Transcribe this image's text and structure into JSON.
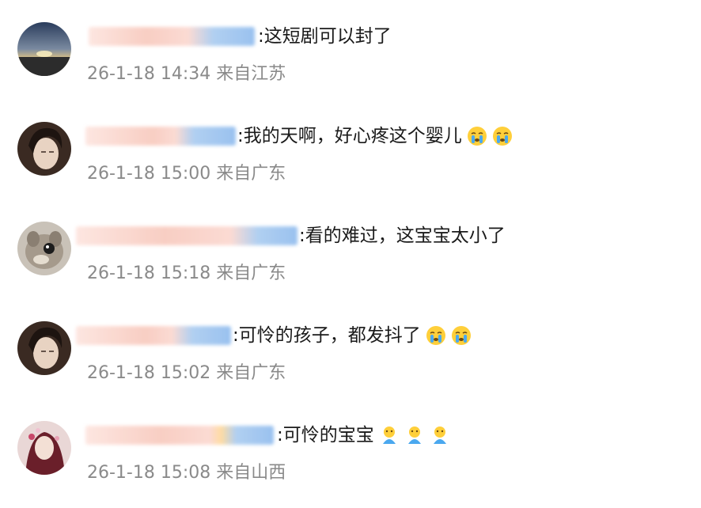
{
  "comments": [
    {
      "text": ":这短剧可以封了",
      "date": "26-1-18 14:34",
      "location": "来自江苏",
      "emojis": []
    },
    {
      "text": ":我的天啊，好心疼这个婴儿",
      "date": "26-1-18 15:00",
      "location": "来自广东",
      "emojis": [
        "crying-face-icon",
        "crying-face-icon"
      ]
    },
    {
      "text": ":看的难过，这宝宝太小了",
      "date": "26-1-18 15:18",
      "location": "来自广东",
      "emojis": []
    },
    {
      "text": ":可怜的孩子，都发抖了",
      "date": "26-1-18 15:02",
      "location": "来自广东",
      "emojis": [
        "crying-face-icon",
        "crying-face-icon"
      ]
    },
    {
      "text": ":可怜的宝宝",
      "date": "26-1-18 15:08",
      "location": "来自山西",
      "emojis": [
        "shivering-person-icon",
        "shivering-person-icon",
        "shivering-person-icon"
      ]
    }
  ]
}
